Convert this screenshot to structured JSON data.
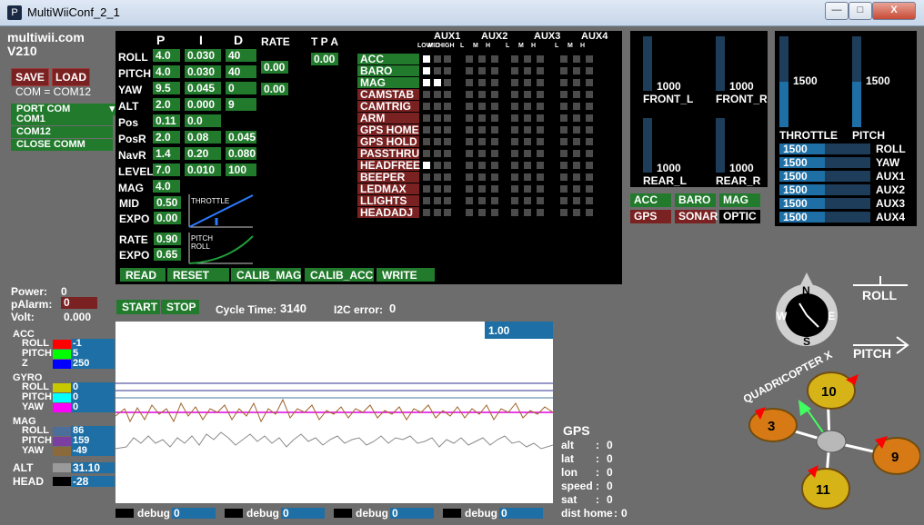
{
  "window": {
    "title": "MultiWiiConf_2_1",
    "minimize": "—",
    "maximize": "□",
    "close": "X"
  },
  "app": {
    "name": "multiwii.com",
    "version": "V210"
  },
  "connection": {
    "save": "SAVE",
    "load": "LOAD",
    "com_status": "COM = COM12",
    "port_label": "PORT COM",
    "ports": [
      "COM1",
      "COM12",
      "CLOSE COMM"
    ]
  },
  "power": {
    "power_label": "Power:",
    "power_value": "0",
    "palarm_label": "pAlarm:",
    "palarm_value": "0",
    "volt_label": "Volt:",
    "volt_value": "0.000"
  },
  "pid": {
    "headers": {
      "p": "P",
      "i": "I",
      "d": "D",
      "rate": "RATE",
      "tpa": "T P A"
    },
    "rows": [
      {
        "label": "ROLL",
        "p": "4.0",
        "i": "0.030",
        "d": "40"
      },
      {
        "label": "PITCH",
        "p": "4.0",
        "i": "0.030",
        "d": "40"
      },
      {
        "label": "YAW",
        "p": "9.5",
        "i": "0.045",
        "d": "0"
      },
      {
        "label": "ALT",
        "p": "2.0",
        "i": "0.000",
        "d": "9"
      },
      {
        "label": "Pos",
        "p": "0.11",
        "i": "0.0",
        "d": ""
      },
      {
        "label": "PosR",
        "p": "2.0",
        "i": "0.08",
        "d": "0.045"
      },
      {
        "label": "NavR",
        "p": "1.4",
        "i": "0.20",
        "d": "0.080"
      },
      {
        "label": "LEVEL",
        "p": "7.0",
        "i": "0.010",
        "d": "100"
      },
      {
        "label": "MAG",
        "p": "4.0",
        "i": "",
        "d": ""
      }
    ],
    "rate_roll_pitch": "0.00",
    "rate_yaw": "0.00",
    "tpa": "0.00",
    "mid_label": "MID",
    "mid_value": "0.50",
    "expo_label": "EXPO",
    "expo_value": "0.00",
    "throttle_curve_label": "THROTTLE",
    "rate_label": "RATE",
    "rate_value": "0.90",
    "expo2_label": "EXPO",
    "expo2_value": "0.65",
    "pitch_roll_curve_label1": "PITCH",
    "pitch_roll_curve_label2": "ROLL",
    "buttons": {
      "read": "READ",
      "reset": "RESET",
      "calib_mag": "CALIB_MAG",
      "calib_acc": "CALIB_ACC",
      "write": "WRITE"
    }
  },
  "aux": {
    "headers": [
      "AUX1",
      "AUX2",
      "AUX3",
      "AUX4"
    ],
    "sub_headers": [
      "LOW",
      "MID",
      "HIGH",
      "L",
      "M",
      "H",
      "L",
      "M",
      "H",
      "L",
      "M",
      "H"
    ],
    "boxes": [
      {
        "name": "ACC",
        "active": true,
        "checks": [
          1,
          0,
          0,
          0,
          0,
          0,
          0,
          0,
          0,
          0,
          0,
          0
        ]
      },
      {
        "name": "BARO",
        "active": true,
        "checks": [
          1,
          0,
          0,
          0,
          0,
          0,
          0,
          0,
          0,
          0,
          0,
          0
        ]
      },
      {
        "name": "MAG",
        "active": true,
        "checks": [
          1,
          1,
          0,
          0,
          0,
          0,
          0,
          0,
          0,
          0,
          0,
          0
        ]
      },
      {
        "name": "CAMSTAB",
        "active": false,
        "checks": [
          0,
          0,
          0,
          0,
          0,
          0,
          0,
          0,
          0,
          0,
          0,
          0
        ]
      },
      {
        "name": "CAMTRIG",
        "active": false,
        "checks": [
          0,
          0,
          0,
          0,
          0,
          0,
          0,
          0,
          0,
          0,
          0,
          0
        ]
      },
      {
        "name": "ARM",
        "active": false,
        "checks": [
          0,
          0,
          0,
          0,
          0,
          0,
          0,
          0,
          0,
          0,
          0,
          0
        ]
      },
      {
        "name": "GPS HOME",
        "active": false,
        "checks": [
          0,
          0,
          0,
          0,
          0,
          0,
          0,
          0,
          0,
          0,
          0,
          0
        ]
      },
      {
        "name": "GPS HOLD",
        "active": false,
        "checks": [
          0,
          0,
          0,
          0,
          0,
          0,
          0,
          0,
          0,
          0,
          0,
          0
        ]
      },
      {
        "name": "PASSTHRU",
        "active": false,
        "checks": [
          0,
          0,
          0,
          0,
          0,
          0,
          0,
          0,
          0,
          0,
          0,
          0
        ]
      },
      {
        "name": "HEADFREE",
        "active": false,
        "checks": [
          1,
          0,
          0,
          0,
          0,
          0,
          0,
          0,
          0,
          0,
          0,
          0
        ]
      },
      {
        "name": "BEEPER",
        "active": false,
        "checks": [
          0,
          0,
          0,
          0,
          0,
          0,
          0,
          0,
          0,
          0,
          0,
          0
        ]
      },
      {
        "name": "LEDMAX",
        "active": false,
        "checks": [
          0,
          0,
          0,
          0,
          0,
          0,
          0,
          0,
          0,
          0,
          0,
          0
        ]
      },
      {
        "name": "LLIGHTS",
        "active": false,
        "checks": [
          0,
          0,
          0,
          0,
          0,
          0,
          0,
          0,
          0,
          0,
          0,
          0
        ]
      },
      {
        "name": "HEADADJ",
        "active": false,
        "checks": [
          0,
          0,
          0,
          0,
          0,
          0,
          0,
          0,
          0,
          0,
          0,
          0
        ]
      }
    ]
  },
  "motors": {
    "front_l": {
      "label": "FRONT_L",
      "value": "1000",
      "level": 0.0
    },
    "front_r": {
      "label": "FRONT_R",
      "value": "1000",
      "level": 0.0
    },
    "rear_l": {
      "label": "REAR_L",
      "value": "1000",
      "level": 0.0
    },
    "rear_r": {
      "label": "REAR_R",
      "value": "1000",
      "level": 0.0
    }
  },
  "sensors_status": [
    {
      "name": "ACC",
      "state": "on"
    },
    {
      "name": "BARO",
      "state": "on"
    },
    {
      "name": "MAG",
      "state": "on"
    },
    {
      "name": "GPS",
      "state": "off"
    },
    {
      "name": "SONAR",
      "state": "off"
    },
    {
      "name": "OPTIC",
      "state": "none"
    }
  ],
  "rc": {
    "throttle": {
      "label": "THROTTLE",
      "value": "1500",
      "level": 0.5
    },
    "pitch": {
      "label": "PITCH",
      "value": "1500",
      "level": 0.5
    },
    "channels": [
      {
        "label": "ROLL",
        "value": "1500"
      },
      {
        "label": "YAW",
        "value": "1500"
      },
      {
        "label": "AUX1",
        "value": "1500"
      },
      {
        "label": "AUX2",
        "value": "1500"
      },
      {
        "label": "AUX3",
        "value": "1500"
      },
      {
        "label": "AUX4",
        "value": "1500"
      }
    ]
  },
  "run": {
    "start": "START",
    "stop": "STOP",
    "cycle_label": "Cycle Time:",
    "cycle_value": "3140",
    "i2c_label": "I2C error:",
    "i2c_value": "0"
  },
  "graph": {
    "scale": "1.00"
  },
  "sensors": {
    "acc": {
      "title": "ACC",
      "rows": [
        {
          "label": "ROLL",
          "value": "-1",
          "color": "#ff0000"
        },
        {
          "label": "PITCH",
          "value": "5",
          "color": "#00ff00"
        },
        {
          "label": "Z",
          "value": "250",
          "color": "#0000ff"
        }
      ]
    },
    "gyro": {
      "title": "GYRO",
      "rows": [
        {
          "label": "ROLL",
          "value": "0",
          "color": "#c8c800"
        },
        {
          "label": "PITCH",
          "value": "0",
          "color": "#00ffff"
        },
        {
          "label": "YAW",
          "value": "0",
          "color": "#ff00ff"
        }
      ]
    },
    "mag": {
      "title": "MAG",
      "rows": [
        {
          "label": "ROLL",
          "value": "86",
          "color": "#4b6e9b"
        },
        {
          "label": "PITCH",
          "value": "159",
          "color": "#7a3fa0"
        },
        {
          "label": "YAW",
          "value": "-49",
          "color": "#8a6a3a"
        }
      ]
    },
    "alt": {
      "label": "ALT",
      "value": "31.10",
      "color": "#9a9a9a"
    },
    "head": {
      "label": "HEAD",
      "value": "-28",
      "color": "#000000"
    }
  },
  "debug": [
    {
      "label": "debug",
      "value": "0"
    },
    {
      "label": "debug",
      "value": "0"
    },
    {
      "label": "debug",
      "value": "0"
    },
    {
      "label": "debug",
      "value": "0"
    }
  ],
  "gps": {
    "title": "GPS",
    "rows": [
      {
        "label": "alt",
        "sep": ":",
        "value": "0"
      },
      {
        "label": "lat",
        "sep": ":",
        "value": "0"
      },
      {
        "label": "lon",
        "sep": ":",
        "value": "0"
      },
      {
        "label": "speed",
        "sep": ":",
        "value": "0"
      },
      {
        "label": "sat",
        "sep": ":",
        "value": "0"
      },
      {
        "label": "dist home",
        "sep": ":",
        "value": "0"
      }
    ]
  },
  "attitude": {
    "roll_label": "ROLL",
    "pitch_label": "PITCH",
    "compass": {
      "n": "N",
      "s": "S",
      "e": "E",
      "w": "W"
    }
  },
  "quad": {
    "label": "QUADRICOPTER X",
    "motors": [
      "10",
      "3",
      "9",
      "11"
    ]
  }
}
